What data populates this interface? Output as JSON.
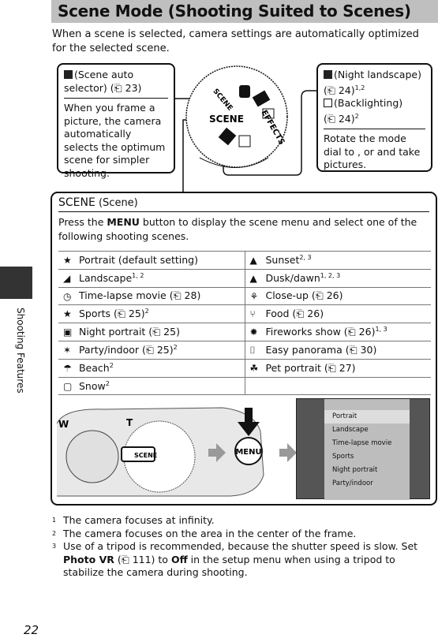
{
  "title": "Scene Mode (Shooting Suited to Scenes)",
  "intro": "When a scene is selected, camera settings are automatically optimized for the selected scene.",
  "side_label": "Shooting Features",
  "callout_left": {
    "heading": "(Scene auto selector) (⎗ 23)",
    "body": "When you frame a picture, the camera automatically selects the optimum scene for simpler shooting."
  },
  "callout_right": {
    "line1": "(Night landscape)",
    "line1b": "(⎗ 24)",
    "line1sup": "1,2",
    "line2": "(Backlighting)",
    "line2b": "(⎗ 24)",
    "line2sup": "2",
    "body": "Rotate the mode dial to , or  and take pictures."
  },
  "dial": {
    "scene": "SCENE",
    "effects": "EFFECTS"
  },
  "scene": {
    "label": "SCENE",
    "sub": "(Scene)",
    "desc_pre": "Press the ",
    "desc_menu": "MENU",
    "desc_post": " button to display the scene menu and select one of the following shooting scenes.",
    "rows": [
      [
        {
          "icon": "portrait-icon",
          "g": "★",
          "t": "Portrait (default setting)",
          "s": ""
        },
        {
          "icon": "sunset-icon",
          "g": "▲",
          "t": "Sunset",
          "s": "2, 3"
        }
      ],
      [
        {
          "icon": "landscape-icon",
          "g": "◢",
          "t": "Landscape",
          "s": "1, 2"
        },
        {
          "icon": "dusk-dawn-icon",
          "g": "▲",
          "t": "Dusk/dawn",
          "s": "1, 2, 3"
        }
      ],
      [
        {
          "icon": "time-lapse-icon",
          "g": "◷",
          "t": "Time-lapse movie (⎗ 28)",
          "s": ""
        },
        {
          "icon": "close-up-icon",
          "g": "⚘",
          "t": "Close-up (⎗ 26)",
          "s": ""
        }
      ],
      [
        {
          "icon": "sports-icon",
          "g": "★",
          "t": "Sports (⎗ 25)",
          "s": "2"
        },
        {
          "icon": "food-icon",
          "g": "⑂",
          "t": "Food (⎗ 26)",
          "s": ""
        }
      ],
      [
        {
          "icon": "night-portrait-icon",
          "g": "▣",
          "t": "Night portrait (⎗ 25)",
          "s": ""
        },
        {
          "icon": "fireworks-icon",
          "g": "✹",
          "t": "Fireworks show (⎗ 26)",
          "s": "1, 3"
        }
      ],
      [
        {
          "icon": "party-indoor-icon",
          "g": "✶",
          "t": "Party/indoor (⎗ 25)",
          "s": "2"
        },
        {
          "icon": "easy-panorama-icon",
          "g": "⌷",
          "t": "Easy panorama (⎗ 30)",
          "s": ""
        }
      ],
      [
        {
          "icon": "beach-icon",
          "g": "☂",
          "t": "Beach",
          "s": "2"
        },
        {
          "icon": "pet-portrait-icon",
          "g": "☘",
          "t": "Pet portrait (⎗ 27)",
          "s": ""
        }
      ],
      [
        {
          "icon": "snow-icon",
          "g": "▢",
          "t": "Snow",
          "s": "2"
        },
        null
      ]
    ]
  },
  "camera": {
    "w": "W",
    "t": "T",
    "scene": "SCENE",
    "menu_button": "MENU"
  },
  "menu_screen": {
    "items": [
      "Portrait",
      "Landscape",
      "Time-lapse movie",
      "Sports",
      "Night portrait",
      "Party/indoor"
    ],
    "selected": "Portrait"
  },
  "footnotes": [
    {
      "n": "1",
      "t": "The camera focuses at infinity."
    },
    {
      "n": "2",
      "t": "The camera focuses on the area in the center of the frame."
    },
    {
      "n": "3",
      "pre": "Use of a tripod is recommended, because the shutter speed is slow. Set ",
      "b1": "Photo VR",
      "mid": " (⎗ 111) to ",
      "b2": "Off",
      "post": " in the setup menu when using a tripod to stabilize the camera during shooting."
    }
  ],
  "page_number": "22"
}
